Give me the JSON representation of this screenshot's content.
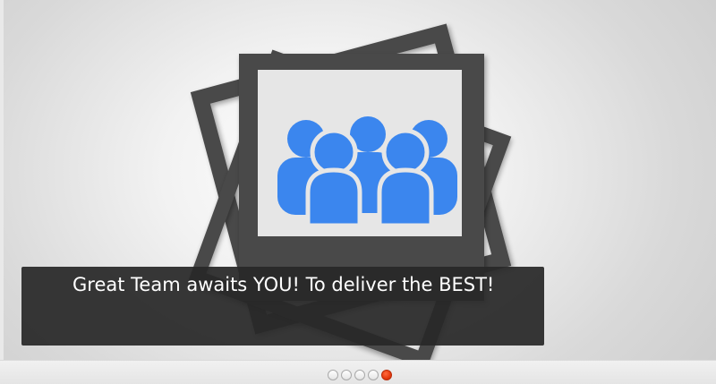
{
  "slider": {
    "caption": "Great Team awaits YOU! To deliver the BEST!",
    "total_slides": 5,
    "active_slide_index": 4
  },
  "colors": {
    "frame": "#4a4a4a",
    "photo_bg": "#e6e6e6",
    "people": "#3b86ee",
    "caption_bg": "#282828",
    "active_dot": "#e63a0e"
  },
  "icons": {
    "slide_image": "team-photo-icon"
  }
}
